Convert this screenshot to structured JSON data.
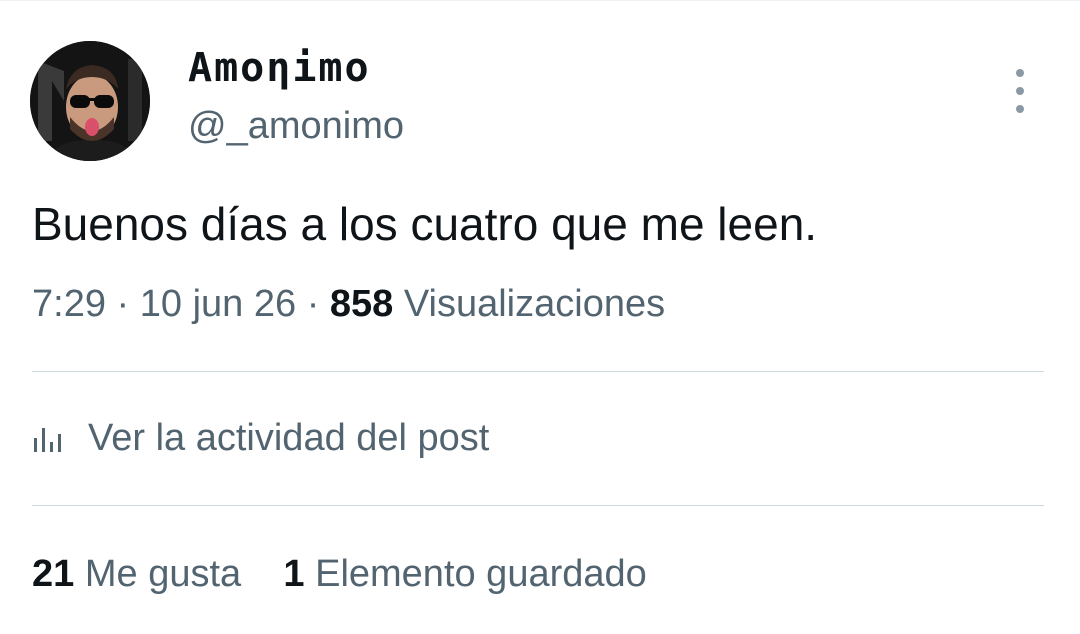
{
  "author": {
    "display_name": "Amoηimo",
    "handle": "@_amonimo",
    "avatar_icon": "profile-photo"
  },
  "tweet": {
    "text": "Buenos días a los cuatro que me leen.",
    "time": "7:29",
    "date": "10 jun 26",
    "separator": "·",
    "views_count": "858",
    "views_label": "Visualizaciones"
  },
  "activity": {
    "label": "Ver la actividad del post",
    "icon": "analytics-icon"
  },
  "stats": {
    "likes_count": "21",
    "likes_label": "Me gusta",
    "bookmarks_count": "1",
    "bookmarks_label": "Elemento guardado"
  },
  "colors": {
    "primary_text": "#0f1419",
    "secondary_text": "#536471",
    "divider": "#cfd9de"
  }
}
